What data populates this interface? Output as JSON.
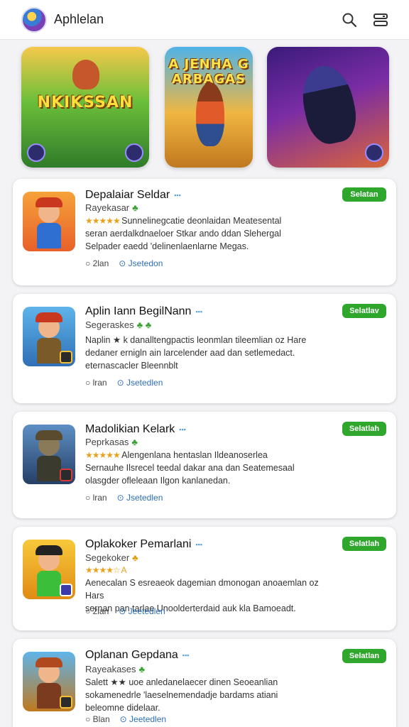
{
  "header": {
    "title": "Aphlelan",
    "search_icon": "search-icon",
    "menu_icon": "menu-icon"
  },
  "banners": [
    {
      "title": "NKIKSSAN",
      "subtitle": ""
    },
    {
      "title": "A JENHA G ARBAGAS",
      "subtitle": ""
    },
    {
      "title": "",
      "subtitle": ""
    }
  ],
  "apps": [
    {
      "title": "Depalaiar Seldar",
      "subtitle": "Rayekasar",
      "desc": [
        "Sunnelinegcatie deonlaidan Meatesental",
        "seran aerdalkdnaeloer Stkar ando ddan Slehergal",
        "Selpader eaedd 'delinenlaenlarne Megas."
      ],
      "meta_count": "2lan",
      "meta_link": "Jsetedon",
      "action": "Selatan",
      "colors": {
        "bg": "#ef8a2b",
        "hat": "#c9371e",
        "body": "#2f6fd1"
      }
    },
    {
      "title": "Aplin Iann BegilNann",
      "subtitle": "Segeraskes",
      "desc": [
        "Naplin ★ k danalltengpactis leonmlan tileemlian oz Hare",
        "dedaner ernigln ain larcelender aad dan setlemedact.",
        "eternascacler Bleennblt"
      ],
      "meta_count": "lran",
      "meta_link": "Jsetedlen",
      "action": "Selatlav",
      "colors": {
        "bg": "#3a8fd8",
        "hat": "#c9371e",
        "body": "#7b5a2a"
      }
    },
    {
      "title": "Madolikian Kelark",
      "subtitle": "Peprkasas",
      "desc": [
        "Alengenlana hentaslan Ildeanoserlea",
        "Sernauhe Ilsrecel teedal dakar ana dan Seatemesaal",
        "olasgder ofleleaan Ilgon kanlanedan."
      ],
      "meta_count": "lran",
      "meta_link": "Jsetedlen",
      "action": "Selatlah",
      "colors": {
        "bg": "#3f6fa8",
        "hat": "#5a4a2e",
        "body": "#3b3a2e"
      }
    },
    {
      "title": "Oplakoker Pemarlani",
      "subtitle": "Segekoker",
      "desc": [
        "Aenecalan S esreaeok dagemian dmonogan anoaemlan oz Hars",
        "sernan pan tarlae Unoolderterdaid auk kla Bamoeadt."
      ],
      "meta_count": "2lan",
      "meta_link": "Jeetedlen",
      "action": "Selatlah",
      "colors": {
        "bg": "#f2b21b",
        "hat": "#222222",
        "body": "#3bbf3a"
      }
    },
    {
      "title": "Oplanan Gepdana",
      "subtitle": "Rayeakases",
      "desc": [
        "Salett ★★ uoe anledanelaecer dinen Seoeanlian",
        "sokamenedrle 'laeselnemendadje bardams atiani",
        "beleomne didelaar."
      ],
      "meta_count": "Blan",
      "meta_link": "Jeetedlen",
      "action": "Selatlan",
      "colors": {
        "bg": "#3ba1d8",
        "hat": "#b04a1e",
        "body": "#7a3b1e"
      }
    }
  ]
}
